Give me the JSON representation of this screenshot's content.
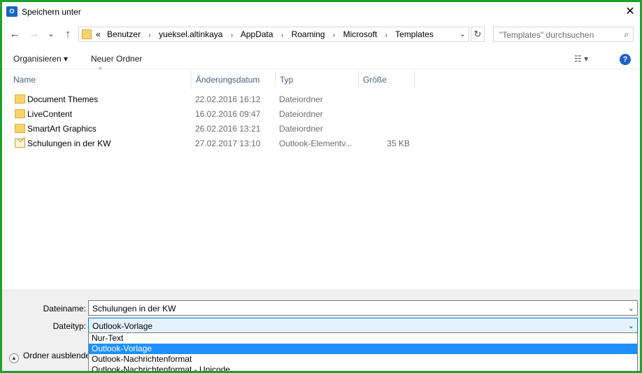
{
  "window": {
    "title": "Speichern unter",
    "app_icon_text": "O",
    "close_label": "✕"
  },
  "nav": {
    "back_label": "←",
    "forward_label": "→",
    "recent_label": "⌄",
    "up_label": "↑",
    "breadcrumb_overflow": "«",
    "breadcrumbs": [
      "Benutzer",
      "yueksel.altinkaya",
      "AppData",
      "Roaming",
      "Microsoft",
      "Templates"
    ],
    "breadcrumb_separator": "›",
    "address_dropdown": "⌄",
    "refresh_label": "↻",
    "search_placeholder": "\"Templates\" durchsuchen",
    "search_icon": "⌕"
  },
  "toolbar": {
    "organize_label": "Organisieren ▾",
    "new_folder_label": "Neuer Ordner",
    "view_label": "☷ ▾",
    "help_label": "?"
  },
  "columns": {
    "name": "Name",
    "modified": "Änderungsdatum",
    "type": "Typ",
    "size": "Größe",
    "sort_indicator": "^"
  },
  "files": [
    {
      "name": "Document Themes",
      "modified": "22.02.2016 16:12",
      "type": "Dateiordner",
      "size": "",
      "icon": "folder-icon"
    },
    {
      "name": "LiveContent",
      "modified": "16.02.2016 09:47",
      "type": "Dateiordner",
      "size": "",
      "icon": "folder-icon"
    },
    {
      "name": "SmartArt Graphics",
      "modified": "26.02.2016 13:21",
      "type": "Dateiordner",
      "size": "",
      "icon": "folder-icon"
    },
    {
      "name": "Schulungen in der KW",
      "modified": "27.02.2017 13:10",
      "type": "Outlook-Elementv...",
      "size": "35 KB",
      "icon": "mail-template-icon"
    }
  ],
  "form": {
    "filename_label": "Dateiname:",
    "filename_value": "Schulungen in der KW",
    "filetype_label": "Dateityp:",
    "filetype_value": "Outlook-Vorlage",
    "dropdown_arrow": "⌄",
    "filetype_options": [
      "Nur-Text",
      "Outlook-Vorlage",
      "Outlook-Nachrichtenformat",
      "Outlook-Nachrichtenformat - Unicode"
    ],
    "selected_option": "Outlook-Vorlage"
  },
  "hide_folders_label": "Ordner ausblenden",
  "hide_folders_icon": "▲",
  "colors": {
    "frame_border": "#1fa12a",
    "selection": "#1e90ff",
    "help_icon": "#1e60c8",
    "header_text": "#4c607a"
  }
}
